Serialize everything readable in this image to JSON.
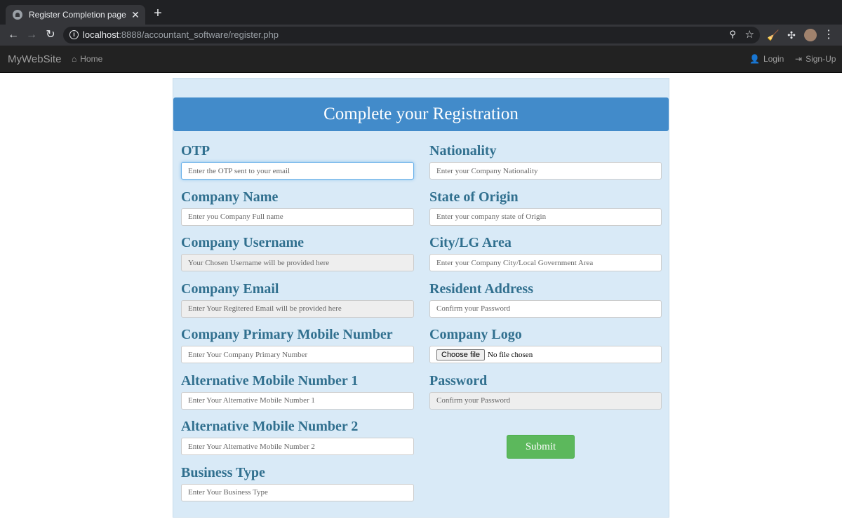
{
  "browser": {
    "tab_title": "Register Completion page",
    "tab_close": "✕",
    "new_tab": "+",
    "url_host": "localhost",
    "url_rest": ":8888/accountant_software/register.php",
    "back": "←",
    "forward": "→",
    "reload": "↻",
    "zoom_icon": "⚲",
    "star_icon": "☆",
    "broom_icon": "🧹",
    "puzzle_icon": "✣",
    "menu_icon": "⋮"
  },
  "navbar": {
    "brand": "MyWebSite",
    "home": "Home",
    "login": "Login",
    "signup": "Sign-Up"
  },
  "form": {
    "heading": "Complete your Registration",
    "left_fields": [
      {
        "label": "OTP",
        "placeholder": "Enter the OTP sent to your email"
      },
      {
        "label": "Company Name",
        "placeholder": "Enter you Company Full name"
      },
      {
        "label": "Company Username",
        "placeholder": "Your Chosen Username will be provided here"
      },
      {
        "label": "Company Email",
        "placeholder": "Enter Your Regitered Email will be provided here"
      },
      {
        "label": "Company Primary Mobile Number",
        "placeholder": "Enter Your Company Primary Number"
      },
      {
        "label": "Alternative Mobile Number 1",
        "placeholder": "Enter Your Alternative Mobile Number 1"
      },
      {
        "label": "Alternative Mobile Number 2",
        "placeholder": "Enter Your Alternative Mobile Number 2"
      },
      {
        "label": "Business Type",
        "placeholder": "Enter Your Business Type"
      }
    ],
    "right_fields": [
      {
        "label": "Nationality",
        "placeholder": "Enter your Company Nationality"
      },
      {
        "label": "State of Origin",
        "placeholder": "Enter your company state of Origin"
      },
      {
        "label": "City/LG Area",
        "placeholder": "Enter your Company City/Local Government Area"
      },
      {
        "label": "Resident Address",
        "placeholder": "Confirm your Password"
      },
      {
        "label": "Company Logo",
        "file_button": "Choose file",
        "file_status": "No file chosen"
      },
      {
        "label": "Password",
        "placeholder": "Confirm your Password"
      }
    ],
    "submit": "Submit"
  }
}
